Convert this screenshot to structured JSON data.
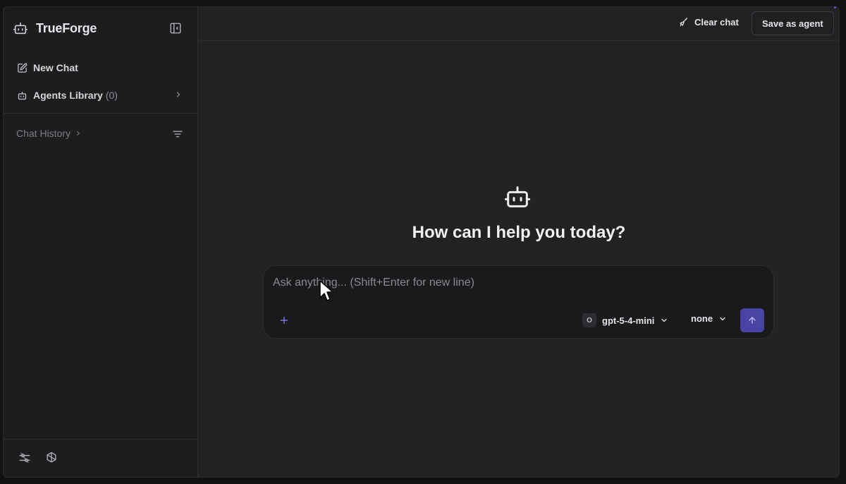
{
  "app": {
    "name": "TrueForge"
  },
  "sidebar": {
    "new_chat": "New Chat",
    "agents_library": "Agents Library",
    "agents_count": "(0)",
    "chat_history": "Chat History"
  },
  "topbar": {
    "clear_chat": "Clear chat",
    "save_as_agent": "Save as agent"
  },
  "main": {
    "greeting": "How can I help you today?"
  },
  "composer": {
    "placeholder": "Ask anything... (Shift+Enter for new line)",
    "model_badge": "O",
    "model": "gpt-5-4-mini",
    "reasoning": "none"
  },
  "colors": {
    "accent": "#4a43a6",
    "plus_icon": "#7b74e0",
    "background": "#222225",
    "sidebar": "#1d1d20"
  },
  "icons": [
    "robot-icon",
    "sidebar-toggle-icon",
    "edit-icon",
    "bot-small-icon",
    "chevron-right-icon",
    "filter-icon",
    "settings-sliders-icon",
    "openai-icon",
    "broom-icon",
    "plus-icon",
    "chevron-down-icon",
    "arrow-up-icon"
  ]
}
